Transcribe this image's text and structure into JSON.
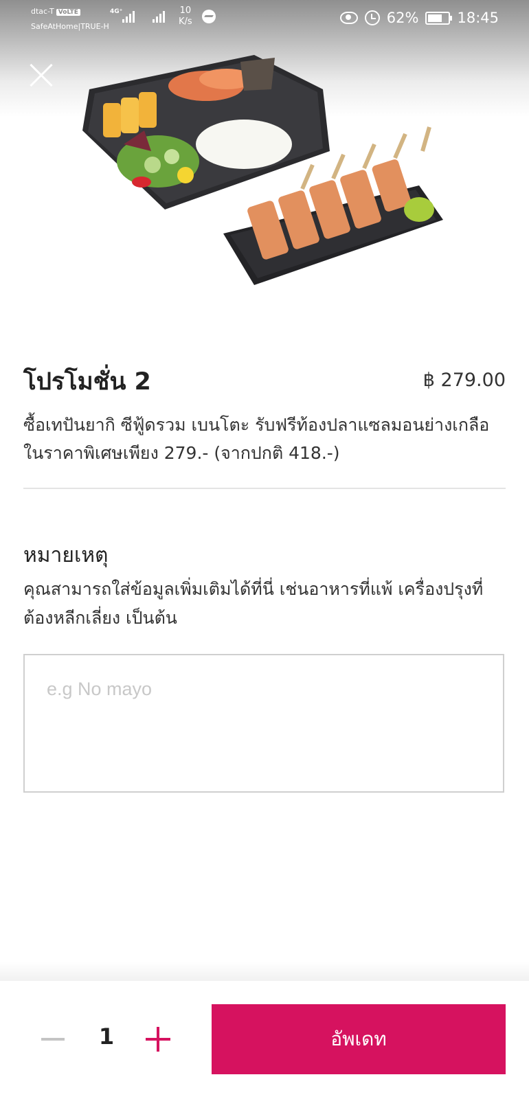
{
  "status_bar": {
    "carrier": "dtac-T",
    "volte": "VoLTE",
    "sub_carrier": "SafeAtHome|TRUE-H",
    "network": "4G⁺",
    "speed_value": "10",
    "speed_unit": "K/s",
    "battery": "62%",
    "battery_level": 0.62,
    "time": "18:45"
  },
  "product": {
    "title": "โปรโมชั่น 2",
    "price": "฿ 279.00",
    "description": "ซื้อเทปันยากิ ซีฟู้ดรวม เบนโตะ รับฟรีท้องปลาแซลมอนย่างเกลือ ในราคาพิเศษเพียง 279.- (จากปกติ 418.-)"
  },
  "note": {
    "title": "หมายเหตุ",
    "description": "คุณสามารถใส่ข้อมูลเพิ่มเติมได้ที่นี่ เช่นอาหารที่แพ้ เครื่องปรุงที่ต้องหลีกเลี่ยง เป็นต้น",
    "placeholder": "e.g No mayo"
  },
  "footer": {
    "quantity": "1",
    "update_label": "อัพเดท"
  },
  "colors": {
    "accent": "#d6125f"
  }
}
